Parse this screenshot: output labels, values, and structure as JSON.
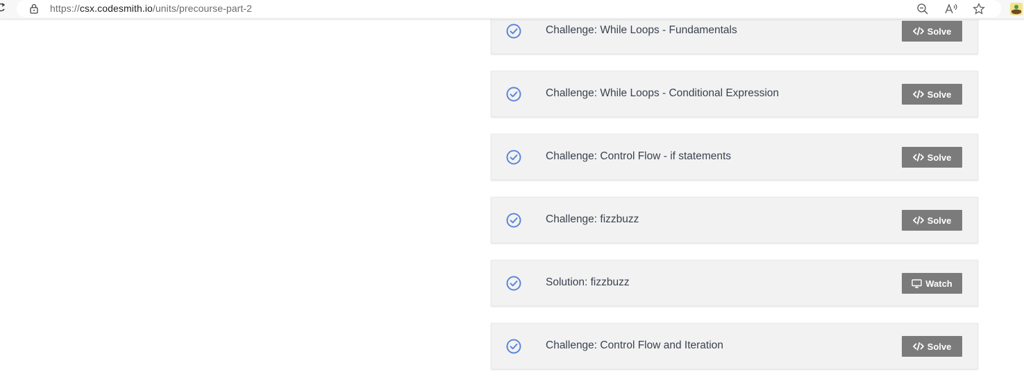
{
  "browser": {
    "url_scheme": "https://",
    "url_host": "csx.codesmith.io",
    "url_path": "/units/precourse-part-2",
    "icons": [
      "reload-icon",
      "lock-icon",
      "zoom-out-icon",
      "read-aloud-icon",
      "favorite-star-icon",
      "profile-icon"
    ]
  },
  "colors": {
    "check": "#5b86d8",
    "button_bg": "#7b7b7b",
    "card_bg": "#f2f2f2",
    "title_text": "#3a4250"
  },
  "lessons": [
    {
      "title": "Challenge: While Loops - Fundamentals",
      "action": "Solve",
      "icon": "code-icon",
      "completed": true
    },
    {
      "title": "Challenge: While Loops - Conditional Expression",
      "action": "Solve",
      "icon": "code-icon",
      "completed": true
    },
    {
      "title": "Challenge: Control Flow - if statements",
      "action": "Solve",
      "icon": "code-icon",
      "completed": true
    },
    {
      "title": "Challenge: fizzbuzz",
      "action": "Solve",
      "icon": "code-icon",
      "completed": true
    },
    {
      "title": "Solution: fizzbuzz",
      "action": "Watch",
      "icon": "monitor-icon",
      "completed": true
    },
    {
      "title": "Challenge: Control Flow and Iteration",
      "action": "Solve",
      "icon": "code-icon",
      "completed": true
    }
  ]
}
